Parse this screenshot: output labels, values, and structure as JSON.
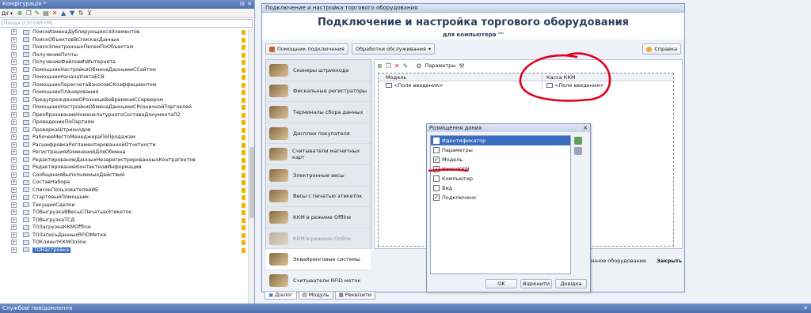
{
  "config_panel": {
    "title": "Конфігурація *",
    "toolbar_actions_label": "Дії ▾",
    "search_placeholder": "Пошук (Ctrl+Alt+M)",
    "items": [
      "ПоискИзменаДублирующихсяЭлементов",
      "ПоискОбъектовВСпискахДанных",
      "ПоискЭлектронныхПисемПоОбъектам",
      "ПолучениеПочты",
      "ПолучениеФайловИзИнтернета",
      "ПомощникНастройкиОбменаДаннымиССайтом",
      "ПомощникНачалаУчетаЕСВ",
      "ПомощникПересчетаВзносовСКоэффициентом",
      "ПомощникПланирования",
      "ПредупреждениеОРазницеВоВремениССервером",
      "ПомощникНастройкиОбменаДаннымиСРозничнойТорговлей",
      "ПреобразованиеНоменклатурногоСоставаДокументаП2",
      "ПроведениеПоПартиям",
      "ПроверкаШтрихкодов",
      "РабочееМестоМенеджераПоПродажам",
      "РасшифровкаРегламентированнойОтчетности",
      "РегистрацияИзмененийДляОбмена",
      "РедактированиеДанныхНезарегистрированныхКонтрагентов",
      "РедактированиеКонтактнойИнформации",
      "СообщенияВыполняемыхДействий",
      "СоставНабора",
      "СписокПользователейИБ",
      "СтартовыйПомощник",
      "ТекущиеСделки",
      "ТОВыгрузкаВВесыСПечатьюЭтикеток",
      "ТОВыгрузкаТСД",
      "ТОЗагрузкаККМOffline",
      "ТОЗаписьДанныхRFIDМетки",
      "ТОКлиентККМOnline",
      "ТОНастройка"
    ],
    "selected_item": "ТОНастройка"
  },
  "main_window": {
    "title": "Подключение и настройка торгового оборудования",
    "header_title": "Подключение и настройка торгового оборудования",
    "header_subtitle": "для компьютера \"\"",
    "actions": {
      "assistant": "Помощник подключения",
      "processing": "Обработки обслуживания",
      "help": "Справка"
    },
    "categories": [
      {
        "label": "Сканеры штрихкода",
        "dim": false
      },
      {
        "label": "Фискальные регистраторы",
        "dim": false
      },
      {
        "label": "Терминалы сбора данных",
        "dim": false
      },
      {
        "label": "Дисплеи покупателя",
        "dim": false
      },
      {
        "label": "Считыватели магнитных карт",
        "dim": false
      },
      {
        "label": "Электронные весы",
        "dim": false
      },
      {
        "label": "Весы с печатью этикеток",
        "dim": false
      },
      {
        "label": "ККМ в режиме Offline",
        "dim": false
      },
      {
        "label": "ККМ в режиме Online",
        "dim": true
      },
      {
        "label": "Эквайринговые системы",
        "dim": false
      },
      {
        "label": "Считыватели RFID меток",
        "dim": false
      }
    ],
    "params_label": "Параметры",
    "grid": {
      "columns": [
        "Модель",
        "Касса ККМ"
      ],
      "row": [
        "<Поле введения>",
        "<Поле введения>"
      ]
    },
    "footer": {
      "link": "ключенное оборудование",
      "close": "Закрыть"
    },
    "tabs": [
      "Діалог",
      "Модуль",
      "Реквізити"
    ]
  },
  "popup": {
    "title": "Розміщення даних",
    "items": [
      {
        "label": "Идентификатор",
        "checked": false,
        "selected": true
      },
      {
        "label": "Параметры",
        "checked": false,
        "selected": false
      },
      {
        "label": "Модель",
        "checked": true,
        "selected": false
      },
      {
        "label": "КассаККМ",
        "checked": true,
        "selected": false
      },
      {
        "label": "Компьютер",
        "checked": false,
        "selected": false
      },
      {
        "label": "Вид",
        "checked": false,
        "selected": false
      },
      {
        "label": "Подключено",
        "checked": true,
        "selected": false
      }
    ],
    "buttons": {
      "ok": "OK",
      "cancel": "Відмінити",
      "help": "Довідка"
    }
  },
  "status_bar": {
    "title": "Службові повідомлення"
  },
  "colors": {
    "accent": "#3b6dc2",
    "annotation": "#e0001b",
    "title_bar": "#5a78b6"
  }
}
